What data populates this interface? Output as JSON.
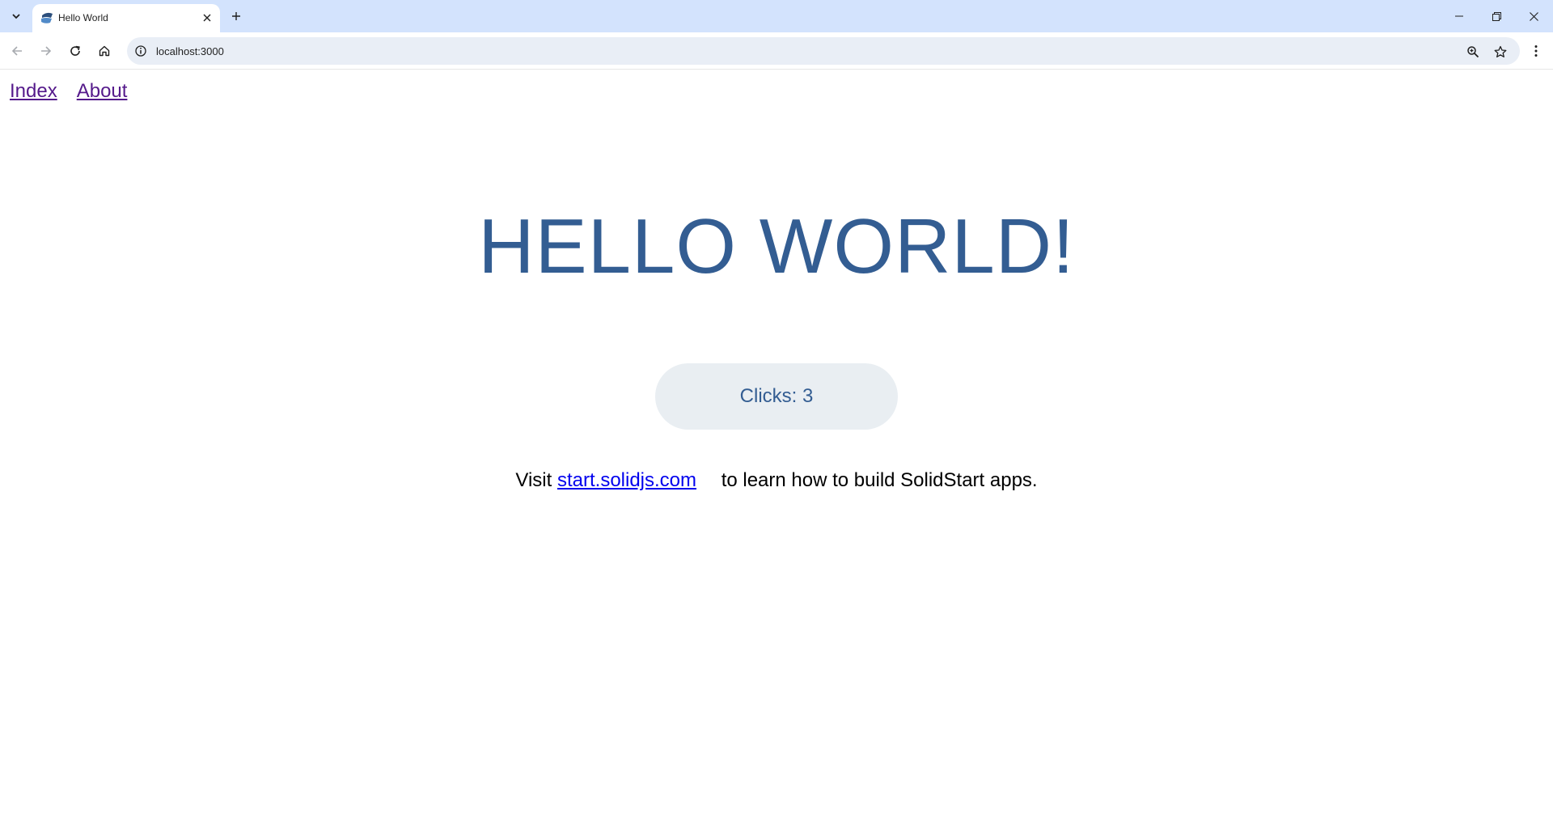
{
  "browser": {
    "tab": {
      "title": "Hello World"
    },
    "address_bar": {
      "url": "localhost:3000"
    }
  },
  "page": {
    "nav": {
      "links": [
        "Index",
        "About"
      ]
    },
    "heading": "HELLO WORLD!",
    "counter_button": "Clicks: 3",
    "footer": {
      "prefix": "Visit",
      "link": "start.solidjs.com",
      "suffix": "to learn how to build SolidStart apps."
    }
  },
  "colors": {
    "tabstrip": "#d3e3fd",
    "heading": "#335d92",
    "button_bg": "#e9eef2",
    "visited_link": "#551a8b",
    "link": "#0000ee"
  },
  "icons": [
    "tab-search-icon",
    "solid-favicon",
    "close-icon",
    "plus-icon",
    "minimize-icon",
    "restore-icon",
    "window-close-icon",
    "back-icon",
    "forward-icon",
    "reload-icon",
    "home-icon",
    "info-icon",
    "zoom-icon",
    "star-icon",
    "more-vert-icon"
  ]
}
